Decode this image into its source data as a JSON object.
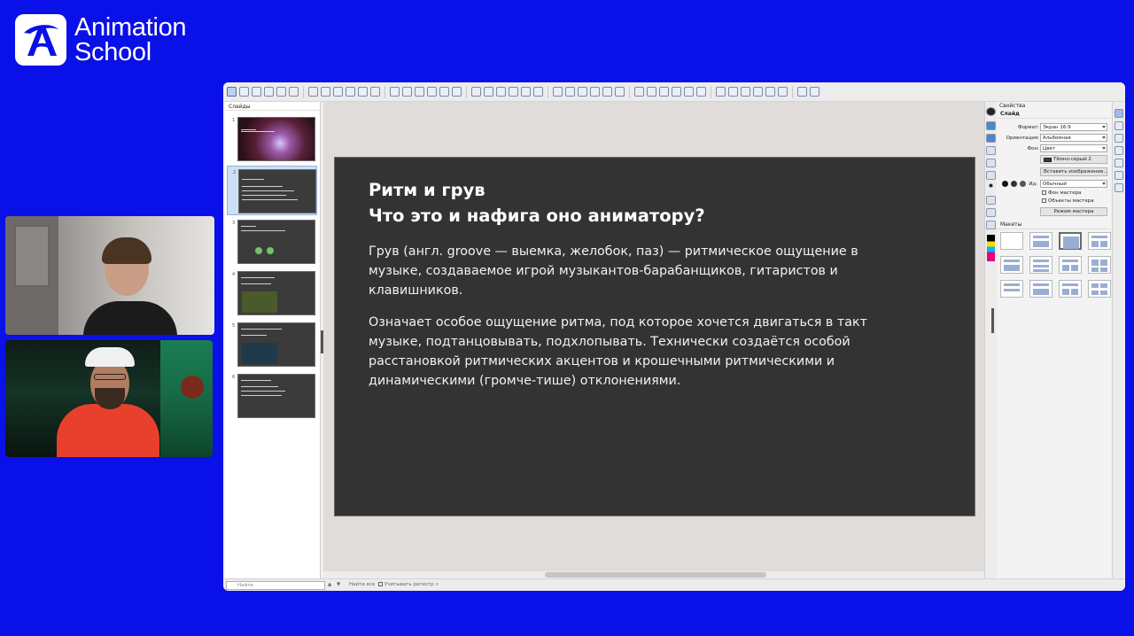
{
  "brand": {
    "line1": "Animation",
    "line2": "School"
  },
  "toolbar": {
    "icon_count": 44,
    "selected_index": 0
  },
  "slides_panel": {
    "title": "Слайды",
    "slides": [
      {
        "num": "1",
        "bg": "#3a2030"
      },
      {
        "num": "2",
        "bg": "#3b3b3b"
      },
      {
        "num": "3",
        "bg": "#3b3b3b"
      },
      {
        "num": "4",
        "bg": "#3b3b3b"
      },
      {
        "num": "5",
        "bg": "#3b3b3b"
      },
      {
        "num": "6",
        "bg": "#3b3b3b"
      }
    ],
    "active_slide": 2
  },
  "slide": {
    "title_line1": "Ритм и грув",
    "title_line2": "Что это и нафига оно аниматору?",
    "para1_lines": [
      "Грув (англ. groove — выемка, желобок, паз) — ритмическое ощущение в",
      "музыке, создаваемое игрой музыкантов-барабанщиков, гитаристов и",
      "клавишников."
    ],
    "para2_lines": [
      "Означает особое ощущение ритма, под которое хочется двигаться в такт",
      "музыке, подтанцовывать, подхлопывать. Технически создаётся особой",
      "расстановкой ритмических акцентов и крошечными ритмическими и",
      "динамическими (громче-тише) отклонениями."
    ]
  },
  "properties": {
    "header": "Свойства",
    "section_slide": "Слайд",
    "format_label": "Формат:",
    "format_value": "Экран 16:9",
    "orientation_label": "Ориентация:",
    "orientation_value": "Альбомная",
    "background_label": "Фон:",
    "background_value": "Цвет",
    "color_value": "Тёмно-серый 2",
    "insert_image": "Вставить изображение...",
    "master_label": "Ид:",
    "master_value": "Обычный",
    "master_bg": "Фон мастера",
    "master_objects": "Объекты мастера",
    "master_mode": "Режим мастера",
    "layouts_head": "Макеты"
  },
  "findbar": {
    "placeholder": "Найти",
    "find_all": "Найти все",
    "match_case": "Учитывать регистр"
  }
}
